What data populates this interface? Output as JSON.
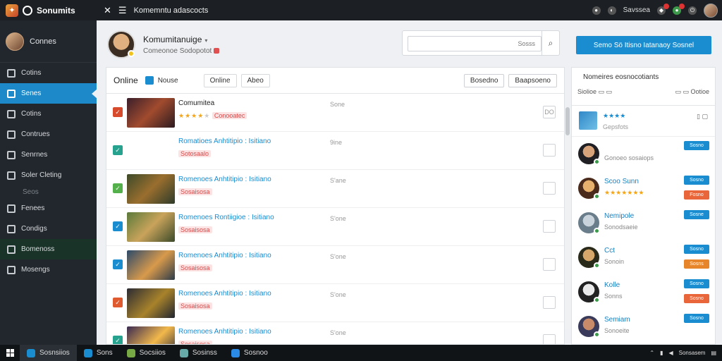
{
  "topbar": {
    "brand": "Sonumits",
    "title": "Komemntu adascocts",
    "status": "Savssea"
  },
  "sidebar": {
    "profile_name": "Connes",
    "items": [
      {
        "label": "Cotins",
        "icon": "dashboard-icon"
      },
      {
        "label": "Senes",
        "icon": "games-icon",
        "active": true
      },
      {
        "label": "Cotins",
        "icon": "library-icon"
      },
      {
        "label": "Contrues",
        "icon": "tools-icon"
      },
      {
        "label": "Senrnes",
        "icon": "grid-icon"
      },
      {
        "label": "Soler Cleting",
        "icon": "edit-icon"
      },
      {
        "label": "Seos",
        "icon": "",
        "dim": true
      },
      {
        "label": "Fenees",
        "icon": "folder-icon"
      },
      {
        "label": "Condigs",
        "icon": "settings-icon"
      },
      {
        "label": "Bomenoss",
        "icon": "book-icon",
        "dark": true
      },
      {
        "label": "Mosengs",
        "icon": "clock-icon"
      }
    ]
  },
  "header": {
    "name": "Komumitanuige",
    "subtitle": "Comeonoe Sodopotot",
    "search_placeholder": "Sosss",
    "primary_button": "Semo Sö Itisno Iatanaoy Sosnel"
  },
  "main": {
    "tab_title": "Online",
    "tab_label": "Nouse",
    "pills": [
      "Online",
      "Abeo"
    ],
    "actions": [
      "Bosedno",
      "Baapsoeno"
    ],
    "rows": [
      {
        "title": "Comumitea",
        "subtitle": "Conooatec",
        "num": "Sone",
        "opt": "DO",
        "check_color": "#d84a2c",
        "thumb": "linear-gradient(135deg,#3b1f2b,#a14b2e 50%,#2b1b20)",
        "title_color": "#222"
      },
      {
        "title": "Romatioes Anhtitipio : Isitiano",
        "subtitle": "Sotosaalo",
        "num": "9ine",
        "opt": "",
        "check_color": "#26a28f",
        "thumb": "#ffffff",
        "title_color": "#1a8dd1"
      },
      {
        "title": "Romenoes Anhtitipio : Isitiano",
        "subtitle": "Sosaisosa",
        "num": "S'ane",
        "opt": "",
        "check_color": "#54b04a",
        "thumb": "linear-gradient(135deg,#3d4a2a,#9a6e2e 50%,#2d3b2a)",
        "title_color": "#1a8dd1"
      },
      {
        "title": "Romenoes Rontiigioe : Isitiano",
        "subtitle": "Sosaisosa",
        "num": "S'one",
        "opt": "",
        "check_color": "#1a8dd1",
        "thumb": "linear-gradient(135deg,#5b7a3b,#c9a35b 50%,#3b4a2a)",
        "title_color": "#1a8dd1"
      },
      {
        "title": "Romenoes Anhtitipio : Isitiano",
        "subtitle": "Sosaisosa",
        "num": "S'one",
        "opt": "",
        "check_color": "#1a8dd1",
        "thumb": "linear-gradient(135deg,#2c4a6a,#d89a4b 55%,#2b3b4a)",
        "title_color": "#1a8dd1"
      },
      {
        "title": "Romenoes Anhtitipio : Isitiano",
        "subtitle": "Sosaisosa",
        "num": "S'one",
        "opt": "",
        "check_color": "#e05a30",
        "thumb": "linear-gradient(135deg,#2b2b33,#a8832b 55%,#1f2430)",
        "title_color": "#1a8dd1"
      },
      {
        "title": "Romenoes Anhtitipio : Isitiano",
        "subtitle": "Sosaisosa",
        "num": "S'one",
        "opt": "",
        "check_color": "#26a28f",
        "thumb": "linear-gradient(135deg,#3a2a52,#f2b84b 55%,#2a2a3a)",
        "title_color": "#1a8dd1"
      }
    ]
  },
  "right": {
    "title": "Nomeires eosnocotiants",
    "tool_left": "Siolioe",
    "tool_right": "Ootioe",
    "top_item": {
      "title": "★★★★",
      "subtitle": "Gepsfots"
    },
    "friends": [
      {
        "name": "",
        "sub": "Gonoeo sosaiops",
        "btn": "Sosno",
        "btn2": "",
        "btn2_color": "",
        "avatar": "radial-gradient(circle at 50% 40%,#d6a37a 0 35%,#1f1f24 36%)"
      },
      {
        "name": "Scoo Sunn",
        "sub": "★★★★★★★",
        "btn": "Sosno",
        "btn2": "Fosno",
        "btn2_color": "#e8663a",
        "avatar": "radial-gradient(circle at 50% 40%,#e7b06c 0 35%,#4a2a1a 36%)"
      },
      {
        "name": "Nemipole",
        "sub": "Sonodsaeie",
        "btn": "Sosne",
        "btn2": "",
        "btn2_color": "",
        "avatar": "radial-gradient(circle at 50% 40%,#c9d3db 0 35%,#6a7d8a 36%)"
      },
      {
        "name": "Cct",
        "sub": "Sonoin",
        "btn": "Sosno",
        "btn2": "Sosns",
        "btn2_color": "#e7852b",
        "avatar": "radial-gradient(circle at 50% 40%,#d6a76a 0 35%,#2a2a1a 36%)"
      },
      {
        "name": "Kolle",
        "sub": "Sonns",
        "btn": "Sosno",
        "btn2": "Sosno",
        "btn2_color": "#e8663a",
        "avatar": "radial-gradient(circle at 50% 40%,#eaeaea 0 35%,#222 36%)"
      },
      {
        "name": "Semiam",
        "sub": "Sonoeite",
        "btn": "Sosno",
        "btn2": "",
        "btn2_color": "",
        "avatar": "radial-gradient(circle at 50% 40%,#c78b6a 0 35%,#3a3a5a 36%)"
      }
    ]
  },
  "taskbar": {
    "items": [
      "Sosnsiios",
      "Sons",
      "Socsiios",
      "Sosinss",
      "Sosnoo"
    ],
    "clock": "Sonsasem"
  }
}
